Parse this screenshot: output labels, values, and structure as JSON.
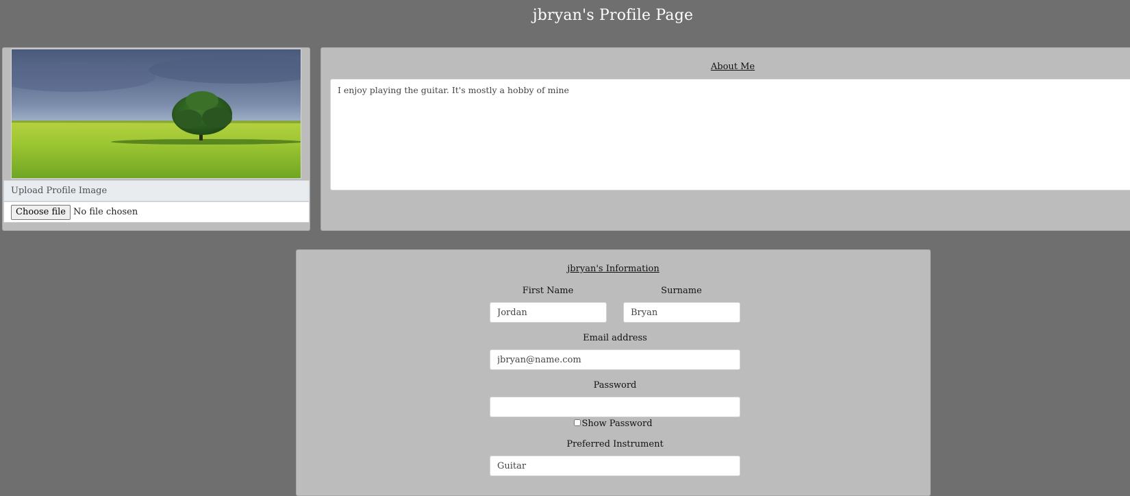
{
  "header": {
    "title": "jbryan's Profile Page"
  },
  "profile_image": {
    "upload_label": "Upload Profile Image",
    "choose_file_label": "Choose file",
    "file_status": "No file chosen"
  },
  "about": {
    "title": "About Me",
    "text": "I enjoy playing the guitar. It's mostly a hobby of mine"
  },
  "info": {
    "title": "jbryan's Information",
    "first_name_label": "First Name",
    "first_name_value": "Jordan",
    "surname_label": "Surname",
    "surname_value": "Bryan",
    "email_label": "Email address",
    "email_value": "jbryan@name.com",
    "password_label": "Password",
    "password_value": "",
    "show_password_label": "Show Password",
    "instrument_label": "Preferred Instrument",
    "instrument_value": "Guitar"
  },
  "colors": {
    "background": "#6f6f6f",
    "panel": "#bcbcbc",
    "title_text": "#ffffff"
  }
}
